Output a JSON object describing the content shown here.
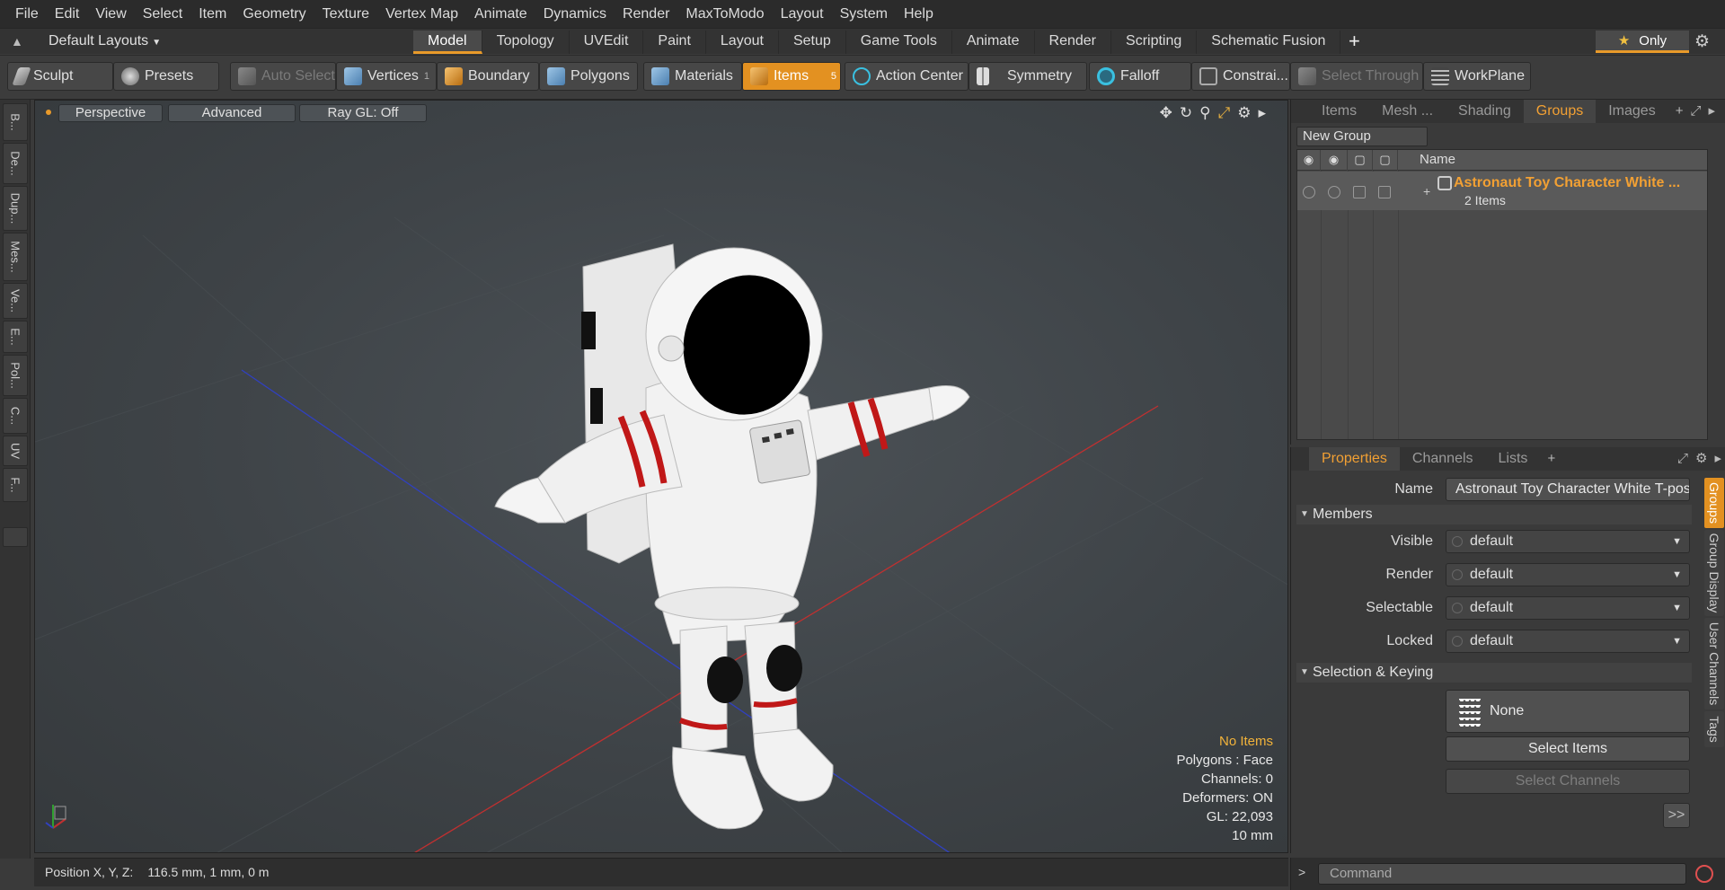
{
  "menu": [
    "File",
    "Edit",
    "View",
    "Select",
    "Item",
    "Geometry",
    "Texture",
    "Vertex Map",
    "Animate",
    "Dynamics",
    "Render",
    "MaxToModo",
    "Layout",
    "System",
    "Help"
  ],
  "layout": {
    "default_layouts": "Default Layouts",
    "tabs": [
      "Model",
      "Topology",
      "UVEdit",
      "Paint",
      "Layout",
      "Setup",
      "Game Tools",
      "Animate",
      "Render",
      "Scripting",
      "Schematic Fusion"
    ],
    "active_tab": "Model",
    "only_label": "Only"
  },
  "toolbar": {
    "sculpt": "Sculpt",
    "presets": "Presets",
    "auto_select": "Auto Select",
    "vertices": "Vertices",
    "vertices_count": "1",
    "boundary": "Boundary",
    "polygons": "Polygons",
    "materials": "Materials",
    "items": "Items",
    "items_count": "5",
    "action_center": "Action Center",
    "symmetry": "Symmetry",
    "falloff": "Falloff",
    "constraints": "Constrai...",
    "select_through": "Select Through",
    "workplane": "WorkPlane"
  },
  "left_tabs": [
    "B...",
    "De...",
    "Dup...",
    "Mes...",
    "Ve...",
    "E...",
    "Pol...",
    "C...",
    "UV",
    "F..."
  ],
  "viewport": {
    "perspective": "Perspective",
    "advanced": "Advanced",
    "raygl": "Ray GL: Off",
    "info": {
      "no_items": "No Items",
      "polygons": "Polygons : Face",
      "channels": "Channels: 0",
      "deformers": "Deformers: ON",
      "gl": "GL: 22,093",
      "scale": "10 mm"
    }
  },
  "status": {
    "label": "Position X, Y, Z:",
    "value": "116.5 mm, 1 mm, 0 m"
  },
  "groups_panel": {
    "tabs": [
      "Items",
      "Mesh ...",
      "Shading",
      "Groups",
      "Images"
    ],
    "active_tab": "Groups",
    "new_group": "New Group",
    "name_col": "Name",
    "row_title": "Astronaut Toy Character White ...",
    "row_sub": "2 Items"
  },
  "properties_panel": {
    "tabs": [
      "Properties",
      "Channels",
      "Lists"
    ],
    "active_tab": "Properties",
    "name_label": "Name",
    "name_value": "Astronaut Toy Character White T-pose",
    "members_section": "Members",
    "visible_label": "Visible",
    "visible_value": "default",
    "render_label": "Render",
    "render_value": "default",
    "selectable_label": "Selectable",
    "selectable_value": "default",
    "locked_label": "Locked",
    "locked_value": "default",
    "selection_section": "Selection & Keying",
    "none_label": "None",
    "select_items": "Select Items",
    "select_channels": "Select Channels",
    "more": ">>",
    "side_tabs": [
      "Groups",
      "Group Display",
      "User Channels",
      "Tags"
    ]
  },
  "command": {
    "placeholder": "Command"
  }
}
